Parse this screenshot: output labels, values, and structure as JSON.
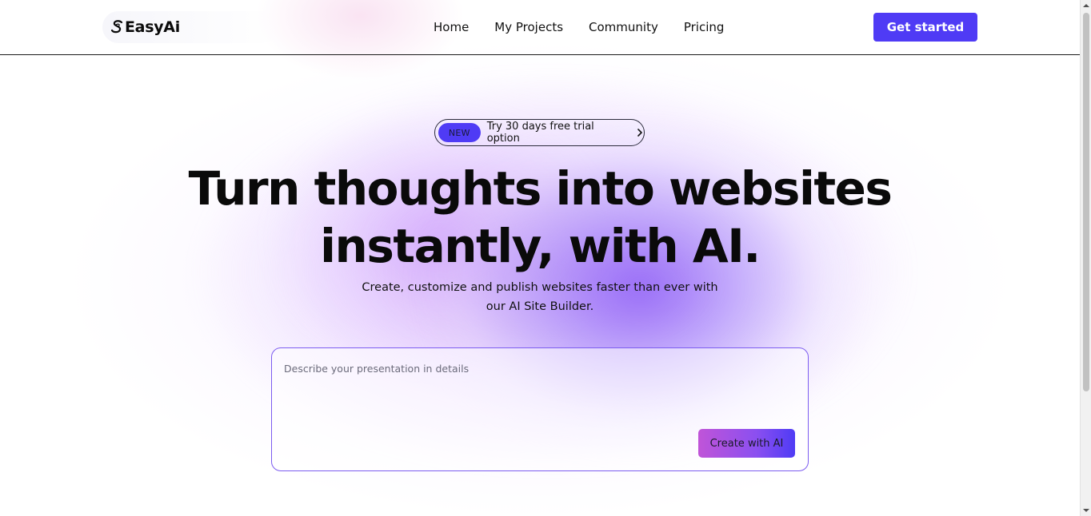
{
  "brand": {
    "logo_icon": "stylized-s-logo-icon",
    "name": "EasyAi"
  },
  "nav": {
    "items": [
      {
        "label": "Home"
      },
      {
        "label": "My Projects"
      },
      {
        "label": "Community"
      },
      {
        "label": "Pricing"
      }
    ],
    "cta_label": "Get started"
  },
  "announcement": {
    "badge": "NEW",
    "text": "Try 30 days free trial option",
    "icon": "chevron-right-icon"
  },
  "hero": {
    "headline_line1": "Turn thoughts into websites",
    "headline_line2": "instantly, with AI.",
    "subtitle_line1": "Create, customize and publish websites faster than ever with",
    "subtitle_line2": "our AI Site Builder."
  },
  "prompt": {
    "placeholder": "Describe your presentation in details",
    "value": "",
    "submit_label": "Create with AI"
  },
  "colors": {
    "accent": "#4f3bf5",
    "gradient_start": "#c054d8",
    "gradient_end": "#4f3bf5",
    "glow": "#8b5cf6"
  }
}
